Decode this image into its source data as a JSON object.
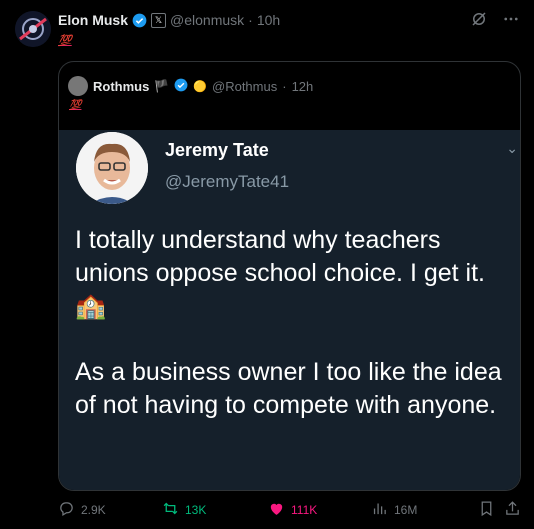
{
  "post": {
    "author_name": "Elon Musk",
    "affiliate_badge": "𝕏",
    "handle": "@elonmusk",
    "separator": "·",
    "time": "10h",
    "text": "💯"
  },
  "quote": {
    "author_name": "Rothmus",
    "emoji_flag": "🏴",
    "emoji_extra": "🟡",
    "handle": "@Rothmus",
    "separator": "·",
    "time": "12h",
    "text": "💯",
    "media": {
      "name": "Jeremy Tate",
      "handle": "@JeremyTate41",
      "paragraph1": "I totally understand why teachers unions oppose school choice. I get it. 🏫",
      "paragraph2": "As a business owner I too like the idea of not having to compete with anyone."
    }
  },
  "actions": {
    "replies": "2.9K",
    "reposts": "13K",
    "likes": "111K",
    "views": "16M"
  },
  "colors": {
    "background": "#000000",
    "verified": "#1d9bf0",
    "repost": "#00ba7c",
    "like": "#f91880",
    "muted": "#71767b"
  },
  "icons": [
    "grok-icon",
    "more-icon",
    "verified-icon",
    "reply-icon",
    "repost-icon",
    "heart-icon",
    "views-icon",
    "bookmark-icon",
    "share-icon"
  ]
}
